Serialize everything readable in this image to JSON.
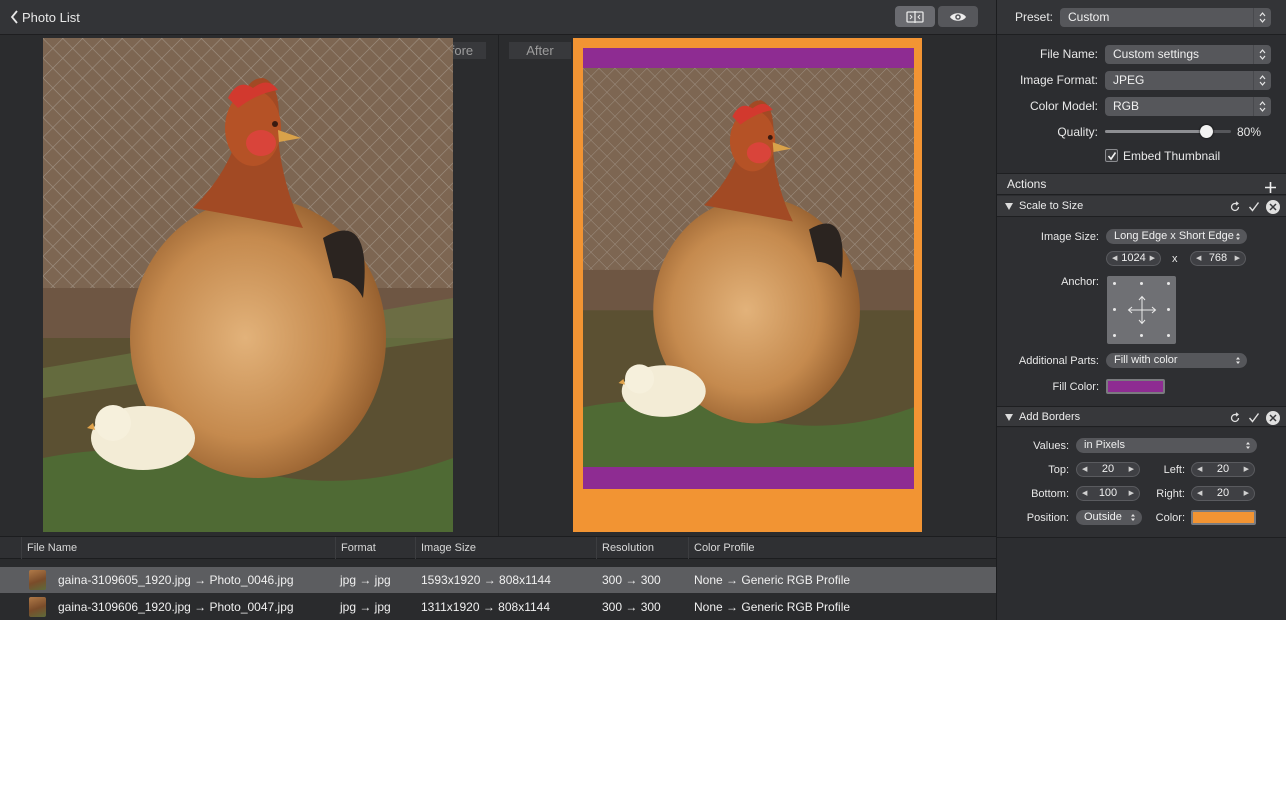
{
  "toolbar": {
    "back_label": "Photo List"
  },
  "preview": {
    "before_label": "Before",
    "after_label": "After"
  },
  "colors": {
    "fill_color": "#8e2c92",
    "border_color": "#f29433"
  },
  "list": {
    "columns": [
      "File Name",
      "Format",
      "Image Size",
      "Resolution",
      "Color Profile"
    ],
    "rows": [
      {
        "file_name": "gaina-3109605_1920.jpg → Photo_0046.jpg",
        "format": "jpg → jpg",
        "size": "1593x1920 → 808x1144",
        "resolution": "300 → 300",
        "profile": "None → Generic RGB Profile"
      },
      {
        "file_name": "gaina-3109606_1920.jpg → Photo_0047.jpg",
        "format": "jpg → jpg",
        "size": "1311x1920 → 808x1144",
        "resolution": "300 → 300",
        "profile": "None → Generic RGB Profile"
      }
    ]
  },
  "sidebar": {
    "preset_label": "Preset:",
    "preset_value": "Custom",
    "file_name_label": "File Name:",
    "file_name_value": "Custom settings",
    "format_label": "Image Format:",
    "format_value": "JPEG",
    "color_model_label": "Color Model:",
    "color_model_value": "RGB",
    "quality_label": "Quality:",
    "quality_value": "80%",
    "quality_fraction": 0.8,
    "embed_thumbnail_label": "Embed Thumbnail",
    "embed_thumbnail_checked": true,
    "actions_title": "Actions",
    "scale": {
      "title": "Scale to Size",
      "image_size_label": "Image Size:",
      "image_size_value": "Long Edge x Short Edge",
      "width": "1024",
      "times": "x",
      "height": "768",
      "anchor_label": "Anchor:",
      "additional_parts_label": "Additional Parts:",
      "additional_parts_value": "Fill with color",
      "fill_color_label": "Fill Color:"
    },
    "borders": {
      "title": "Add Borders",
      "values_label": "Values:",
      "values_value": "in Pixels",
      "top_label": "Top:",
      "top_value": "20",
      "left_label": "Left:",
      "left_value": "20",
      "bottom_label": "Bottom:",
      "bottom_value": "100",
      "right_label": "Right:",
      "right_value": "20",
      "position_label": "Position:",
      "position_value": "Outside",
      "color_label": "Color:"
    }
  }
}
